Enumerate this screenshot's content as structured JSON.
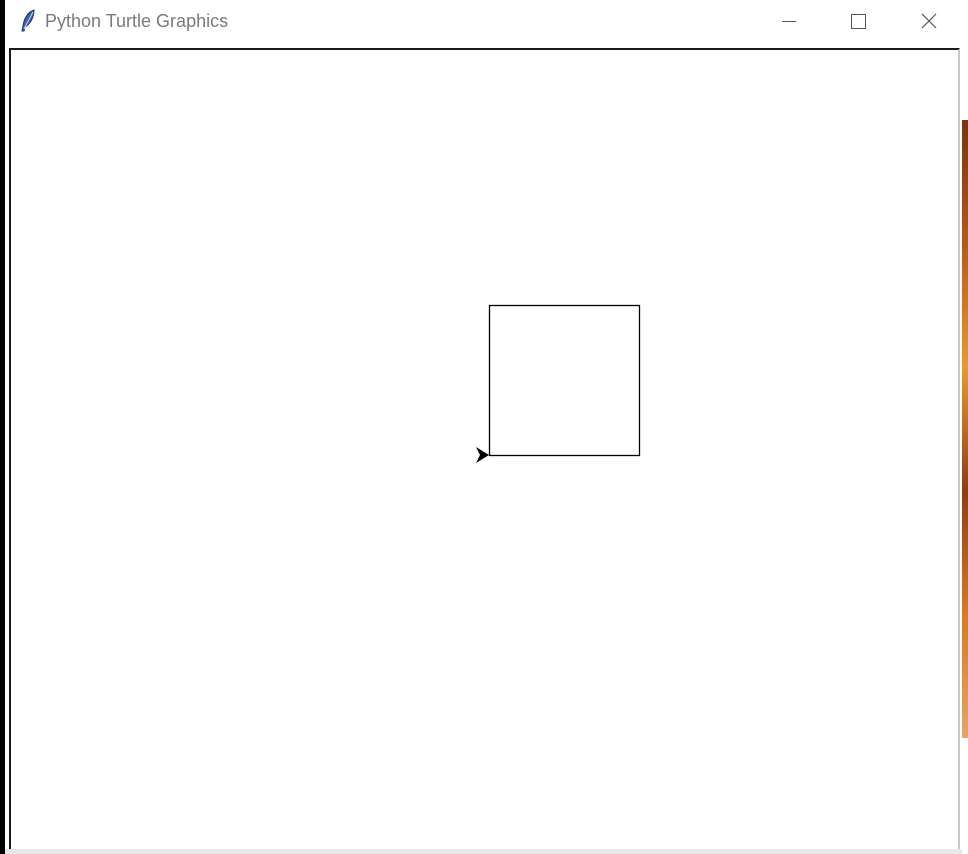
{
  "window": {
    "title": "Python Turtle Graphics",
    "app_icon": "feather-icon",
    "controls": {
      "minimize_icon": "minimize-icon",
      "maximize_icon": "maximize-icon",
      "close_icon": "close-icon"
    }
  },
  "canvas": {
    "background": "#ffffff",
    "drawing": {
      "shape": "square",
      "stroke_color": "#000000"
    },
    "turtle": {
      "shape": "arrow",
      "color": "#000000",
      "heading": "east"
    }
  }
}
